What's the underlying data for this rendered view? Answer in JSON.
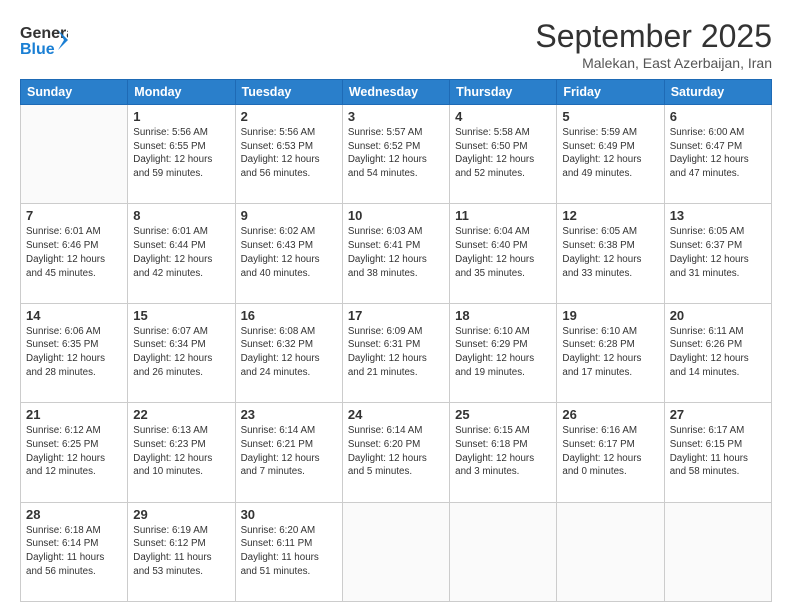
{
  "logo": {
    "line1": "General",
    "line2": "Blue"
  },
  "title": "September 2025",
  "subtitle": "Malekan, East Azerbaijan, Iran",
  "days": [
    "Sunday",
    "Monday",
    "Tuesday",
    "Wednesday",
    "Thursday",
    "Friday",
    "Saturday"
  ],
  "weeks": [
    [
      {
        "day": "",
        "info": ""
      },
      {
        "day": "1",
        "info": "Sunrise: 5:56 AM\nSunset: 6:55 PM\nDaylight: 12 hours\nand 59 minutes."
      },
      {
        "day": "2",
        "info": "Sunrise: 5:56 AM\nSunset: 6:53 PM\nDaylight: 12 hours\nand 56 minutes."
      },
      {
        "day": "3",
        "info": "Sunrise: 5:57 AM\nSunset: 6:52 PM\nDaylight: 12 hours\nand 54 minutes."
      },
      {
        "day": "4",
        "info": "Sunrise: 5:58 AM\nSunset: 6:50 PM\nDaylight: 12 hours\nand 52 minutes."
      },
      {
        "day": "5",
        "info": "Sunrise: 5:59 AM\nSunset: 6:49 PM\nDaylight: 12 hours\nand 49 minutes."
      },
      {
        "day": "6",
        "info": "Sunrise: 6:00 AM\nSunset: 6:47 PM\nDaylight: 12 hours\nand 47 minutes."
      }
    ],
    [
      {
        "day": "7",
        "info": "Sunrise: 6:01 AM\nSunset: 6:46 PM\nDaylight: 12 hours\nand 45 minutes."
      },
      {
        "day": "8",
        "info": "Sunrise: 6:01 AM\nSunset: 6:44 PM\nDaylight: 12 hours\nand 42 minutes."
      },
      {
        "day": "9",
        "info": "Sunrise: 6:02 AM\nSunset: 6:43 PM\nDaylight: 12 hours\nand 40 minutes."
      },
      {
        "day": "10",
        "info": "Sunrise: 6:03 AM\nSunset: 6:41 PM\nDaylight: 12 hours\nand 38 minutes."
      },
      {
        "day": "11",
        "info": "Sunrise: 6:04 AM\nSunset: 6:40 PM\nDaylight: 12 hours\nand 35 minutes."
      },
      {
        "day": "12",
        "info": "Sunrise: 6:05 AM\nSunset: 6:38 PM\nDaylight: 12 hours\nand 33 minutes."
      },
      {
        "day": "13",
        "info": "Sunrise: 6:05 AM\nSunset: 6:37 PM\nDaylight: 12 hours\nand 31 minutes."
      }
    ],
    [
      {
        "day": "14",
        "info": "Sunrise: 6:06 AM\nSunset: 6:35 PM\nDaylight: 12 hours\nand 28 minutes."
      },
      {
        "day": "15",
        "info": "Sunrise: 6:07 AM\nSunset: 6:34 PM\nDaylight: 12 hours\nand 26 minutes."
      },
      {
        "day": "16",
        "info": "Sunrise: 6:08 AM\nSunset: 6:32 PM\nDaylight: 12 hours\nand 24 minutes."
      },
      {
        "day": "17",
        "info": "Sunrise: 6:09 AM\nSunset: 6:31 PM\nDaylight: 12 hours\nand 21 minutes."
      },
      {
        "day": "18",
        "info": "Sunrise: 6:10 AM\nSunset: 6:29 PM\nDaylight: 12 hours\nand 19 minutes."
      },
      {
        "day": "19",
        "info": "Sunrise: 6:10 AM\nSunset: 6:28 PM\nDaylight: 12 hours\nand 17 minutes."
      },
      {
        "day": "20",
        "info": "Sunrise: 6:11 AM\nSunset: 6:26 PM\nDaylight: 12 hours\nand 14 minutes."
      }
    ],
    [
      {
        "day": "21",
        "info": "Sunrise: 6:12 AM\nSunset: 6:25 PM\nDaylight: 12 hours\nand 12 minutes."
      },
      {
        "day": "22",
        "info": "Sunrise: 6:13 AM\nSunset: 6:23 PM\nDaylight: 12 hours\nand 10 minutes."
      },
      {
        "day": "23",
        "info": "Sunrise: 6:14 AM\nSunset: 6:21 PM\nDaylight: 12 hours\nand 7 minutes."
      },
      {
        "day": "24",
        "info": "Sunrise: 6:14 AM\nSunset: 6:20 PM\nDaylight: 12 hours\nand 5 minutes."
      },
      {
        "day": "25",
        "info": "Sunrise: 6:15 AM\nSunset: 6:18 PM\nDaylight: 12 hours\nand 3 minutes."
      },
      {
        "day": "26",
        "info": "Sunrise: 6:16 AM\nSunset: 6:17 PM\nDaylight: 12 hours\nand 0 minutes."
      },
      {
        "day": "27",
        "info": "Sunrise: 6:17 AM\nSunset: 6:15 PM\nDaylight: 11 hours\nand 58 minutes."
      }
    ],
    [
      {
        "day": "28",
        "info": "Sunrise: 6:18 AM\nSunset: 6:14 PM\nDaylight: 11 hours\nand 56 minutes."
      },
      {
        "day": "29",
        "info": "Sunrise: 6:19 AM\nSunset: 6:12 PM\nDaylight: 11 hours\nand 53 minutes."
      },
      {
        "day": "30",
        "info": "Sunrise: 6:20 AM\nSunset: 6:11 PM\nDaylight: 11 hours\nand 51 minutes."
      },
      {
        "day": "",
        "info": ""
      },
      {
        "day": "",
        "info": ""
      },
      {
        "day": "",
        "info": ""
      },
      {
        "day": "",
        "info": ""
      }
    ]
  ]
}
